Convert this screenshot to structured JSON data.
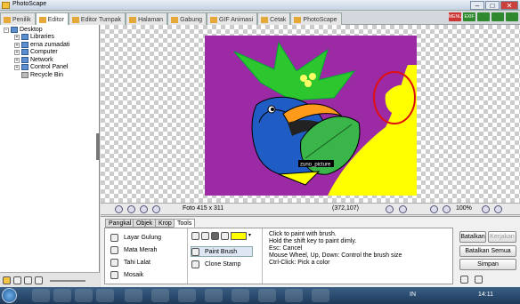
{
  "window": {
    "title": "PhotoScape"
  },
  "tabs": [
    {
      "label": "Penilik"
    },
    {
      "label": "Editor"
    },
    {
      "label": "Editor Tumpak"
    },
    {
      "label": "Halaman"
    },
    {
      "label": "Gabung"
    },
    {
      "label": "GIF Animasi"
    },
    {
      "label": "Cetak"
    },
    {
      "label": "PhotoScape"
    }
  ],
  "tree": [
    {
      "label": "Desktop"
    },
    {
      "label": "Libraries"
    },
    {
      "label": "erna zumadati"
    },
    {
      "label": "Computer"
    },
    {
      "label": "Network"
    },
    {
      "label": "Control Panel"
    },
    {
      "label": "Recycle Bin"
    }
  ],
  "image": {
    "caption": "zuno_picture"
  },
  "status": {
    "size": "Foto 415 x 311",
    "coords": "(372,107)",
    "zoom": "100%"
  },
  "panel_tabs": [
    {
      "label": "Pangkal"
    },
    {
      "label": "Objek"
    },
    {
      "label": "Krop"
    },
    {
      "label": "Tools"
    }
  ],
  "tools": {
    "layar_gulung": "Layar Gulung",
    "mata_merah": "Mata Merah",
    "tahi_lalat": "Tahi Lalat",
    "mosaik": "Mosaik",
    "paint_brush": "Paint Brush",
    "clone_stamp": "Clone Stamp",
    "help1": "Click to paint with brush.",
    "help2": "Hold the shift key to paint dimly.",
    "help3": "Esc: Cancel",
    "help4": "Mouse Wheel, Up, Down: Control the brush size",
    "help5": "Ctrl-Click: Pick a color"
  },
  "buttons": {
    "batalkan": "Batalkan",
    "kerjakan": "Kerjakan",
    "batalkan_semua": "Batalkan Semua",
    "simpan": "Simpan"
  },
  "taskbar": {
    "lang": "IN",
    "time": "14:11"
  },
  "colors": {
    "paint": "#ffff00",
    "canvas_bg": "#9b2aa4"
  }
}
